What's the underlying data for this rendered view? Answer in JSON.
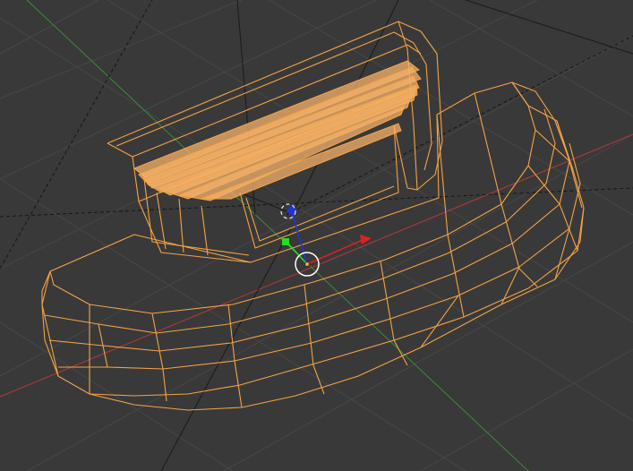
{
  "viewport": {
    "view": "3D Viewport",
    "display_mode": "wireframe",
    "background_color": "#393939",
    "grid_color": "#474747",
    "selected_object_color": "#f4a345",
    "selected_face_fill": "#f6b26b",
    "axis_x_color": "#b33a3a",
    "axis_y_color": "#3a8a3a",
    "dashed_line_color": "#111111"
  },
  "scene": {
    "object": {
      "name": "",
      "selected": true,
      "style": "wireframe mesh"
    },
    "gizmo": {
      "type": "translate",
      "x_handle_color": "#e02020",
      "y_handle_color": "#22dd22",
      "z_handle_color": "#2233dd",
      "pivot_icon": "origin-circle-icon",
      "cursor_icon": "3d-cursor-icon"
    }
  }
}
